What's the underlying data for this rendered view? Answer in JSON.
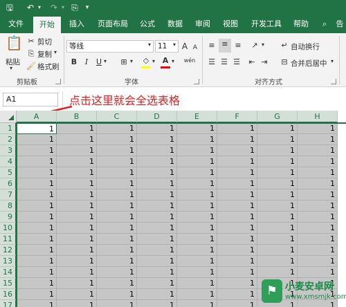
{
  "tabs": [
    "文件",
    "开始",
    "插入",
    "页面布局",
    "公式",
    "数据",
    "审阅",
    "视图",
    "开发工具",
    "帮助",
    "告"
  ],
  "active_tab": "开始",
  "clipboard": {
    "paste": "粘贴",
    "cut": "剪切",
    "copy": "复制",
    "format_painter": "格式刷",
    "group_label": "剪贴板"
  },
  "font": {
    "name": "等线",
    "size": "11",
    "grow": "A",
    "shrink": "A",
    "bold": "B",
    "italic": "I",
    "underline": "U",
    "font_color_glyph": "A",
    "phonetic": "wén",
    "group_label": "字体",
    "font_color": "#ff0000",
    "fill_color": "#ffff00"
  },
  "alignment": {
    "wrap_text": "自动换行",
    "merge_center": "合并后居中",
    "group_label": "对齐方式"
  },
  "name_box": "A1",
  "annotation": "点击这里就会全选表格",
  "columns": [
    "A",
    "B",
    "C",
    "D",
    "E",
    "F",
    "G",
    "H"
  ],
  "rows": [
    "1",
    "2",
    "3",
    "4",
    "5",
    "6",
    "7",
    "8",
    "9",
    "10",
    "11",
    "12",
    "13",
    "14",
    "15",
    "16",
    "17"
  ],
  "cell_value": "1",
  "watermark": {
    "title": "小麦安卓网",
    "url": "www.xmsmjk.com"
  },
  "accent_color": "#217346"
}
